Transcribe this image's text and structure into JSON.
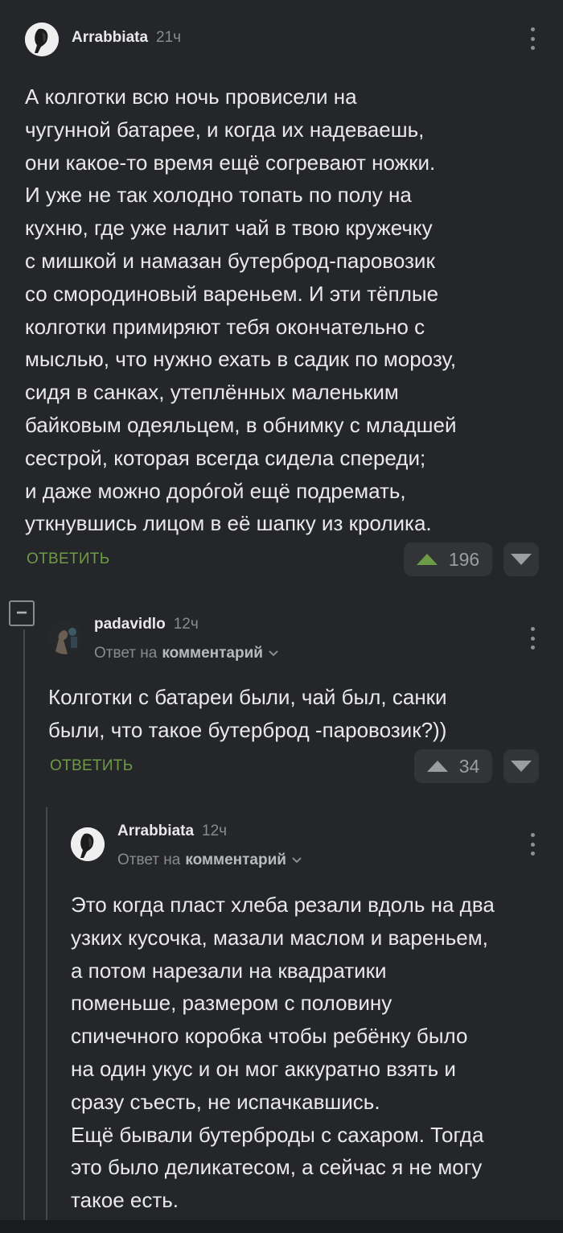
{
  "comments": [
    {
      "author": "Arrabbiata",
      "time": "21ч",
      "text": "А колготки всю ночь провисели на\nчугунной батарее, и когда их надеваешь,\nони какое-то время ещё согревают ножки.\nИ уже не так холодно топать по полу на\nкухню, где уже налит чай в твою кружечку\nс мишкой и намазан бутерброд-паровозик\nсо смородиновый вареньем. И эти тёплые\nколготки примиряют тебя окончательно с\nмыслью, что нужно ехать в садик по морозу,\nсидя в санках, утеплённых маленьким\nбайковым одеяльцем, в обнимку с младшей\nсестрой, которая всегда сидела спереди;\nи даже можно дорóгой ещё подремать,\nуткнувшись лицом в её шапку из кролика.",
      "reply_label": "ОТВЕТИТЬ",
      "score": "196",
      "upvote_color": "#6e9b47"
    },
    {
      "author": "padavidlo",
      "time": "12ч",
      "reply_prefix": "Ответ на",
      "reply_target": "комментарий",
      "text": "Колготки с батареи были, чай был, санки\nбыли, что такое бутерброд -паровозик?))",
      "reply_label": "ОТВЕТИТЬ",
      "score": "34"
    },
    {
      "author": "Arrabbiata",
      "time": "12ч",
      "reply_prefix": "Ответ на",
      "reply_target": "комментарий",
      "text": "Это когда пласт хлеба резали вдоль на два\nузких кусочка, мазали маслом и вареньем,\nа потом нарезали на квадратики\nпоменьше, размером с половину\nспичечного коробка чтобы ребёнку было\nна один укус и он мог аккуратно взять и\nсразу съесть, не испачкавшись.\nЕщё бывали бутерброды с сахаром. Тогда\nэто было деликатесом, а сейчас я не могу\nтакое есть."
    }
  ],
  "collapse_symbol": "−",
  "colors": {
    "background": "#252629",
    "reply_green": "#6e9b47",
    "vote_box": "#333438"
  }
}
